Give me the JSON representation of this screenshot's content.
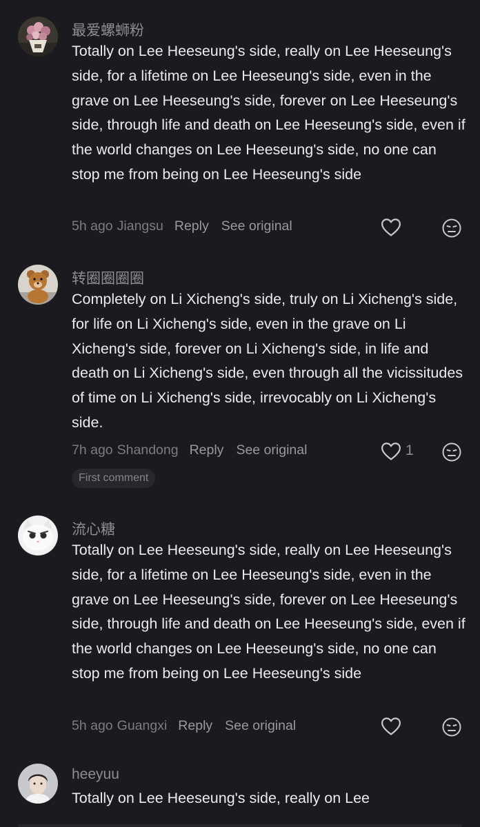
{
  "comments": [
    {
      "username": "最爱螺蛳粉",
      "text": "Totally on Lee Heeseung's side, really on Lee Heeseung's side, for a lifetime on Lee Heeseung's side, even in the grave on Lee Heeseung's side, forever on Lee Heeseung's side, through life and death on Lee Heeseung's side, even if the world changes on Lee Heeseung's side, no one can stop me from being on Lee Heeseung's side",
      "time": "5h ago",
      "location": "Jiangsu",
      "reply_label": "Reply",
      "see_original_label": "See original",
      "like_count": "",
      "avatar_icon": "flower-bouquet-avatar"
    },
    {
      "username": "转圈圈圈圈",
      "text": "Completely on Li Xicheng's side, truly on Li Xicheng's side, for life on Li Xicheng's side, even in the grave on Li Xicheng's side, forever on Li Xicheng's side, in life and death on Li Xicheng's side, even through all the vicissitudes of time on Li Xicheng's side, irrevocably on Li Xicheng's side.",
      "time": "7h ago",
      "location": "Shandong",
      "reply_label": "Reply",
      "see_original_label": "See original",
      "like_count": "1",
      "badge": "First comment",
      "avatar_icon": "teddy-bear-avatar"
    },
    {
      "username": "流心糖",
      "text": "Totally on Lee Heeseung's side, really on Lee Heeseung's side, for a lifetime on Lee Heeseung's side, even in the grave on Lee Heeseung's side, forever on Lee Heeseung's side, through life and death on Lee Heeseung's side, even if the world changes on Lee Heeseung's side, no one can stop me from being on Lee Heeseung's side",
      "time": "5h ago",
      "location": "Guangxi",
      "reply_label": "Reply",
      "see_original_label": "See original",
      "like_count": "",
      "avatar_icon": "white-cat-avatar"
    },
    {
      "username": "heeyuu",
      "text": "Totally on Lee Heeseung's side, really on Lee",
      "avatar_icon": "person-photo-avatar"
    }
  ],
  "icons": {
    "like": "heart-icon",
    "dislike": "meh-face-icon"
  },
  "colors": {
    "background": "#1b1a1f",
    "text": "#ecebef",
    "secondary": "#8e8c94"
  }
}
